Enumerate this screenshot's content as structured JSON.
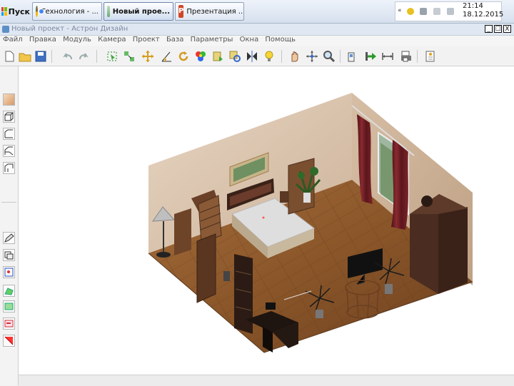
{
  "taskbar": {
    "start_label": "Пуск",
    "tasks": [
      {
        "label": "Технология - ...",
        "icon": "chrome-icon",
        "active": false
      },
      {
        "label": "Новый прое...",
        "icon": "astron-app-icon",
        "active": true
      },
      {
        "label": "Презентация ...",
        "icon": "powerpoint-icon",
        "active": false
      }
    ],
    "clock_time": "21:14",
    "clock_date": "18.12.2015"
  },
  "window": {
    "title": "Новый проект - Астрон Дизайн",
    "controls": [
      "_",
      "☐",
      "X"
    ]
  },
  "menu": [
    "Файл",
    "Правка",
    "Модуль",
    "Камера",
    "Проект",
    "База",
    "Параметры",
    "Окна",
    "Помощь"
  ],
  "toolbar_icons": [
    "new-document-icon",
    "open-folder-icon",
    "save-icon",
    "undo-icon",
    "redo-icon",
    "select-icon",
    "move-group-icon",
    "move-icon",
    "rotate-angle-icon",
    "rotate-icon",
    "materials-icon",
    "paint-icon",
    "copy-icon",
    "mirror-icon",
    "light-bulb-icon",
    "hand-pan-icon",
    "orbit-icon",
    "zoom-icon",
    "wall-icon",
    "arrow-right-icon",
    "dimension-icon",
    "print-icon",
    "info-icon"
  ],
  "left_icons": [
    "object-color-icon",
    "box-icon",
    "wall-profile-icon",
    "wall-angle-icon",
    "wall-corner-icon",
    "pencil-edit-icon",
    "view-layers-icon",
    "camera-front-icon",
    "plan-view-icon",
    "rectangle-view-icon",
    "red-arrow-icon",
    "red-corner-icon"
  ],
  "colors": {
    "floor": "#8d5a2e",
    "wall": "#d9c4ae",
    "curtain": "#6e1f24",
    "furniture_dark": "#3a2117"
  }
}
